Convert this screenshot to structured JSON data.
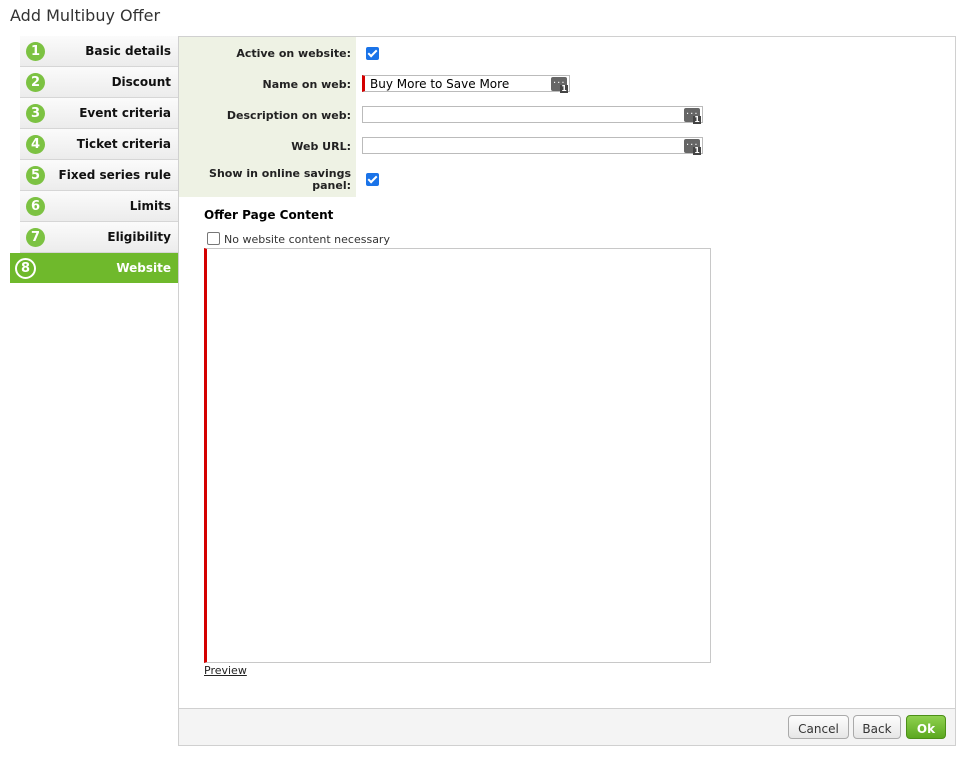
{
  "window": {
    "title": "Add Multibuy Offer"
  },
  "steps": [
    {
      "num": "1",
      "label": "Basic details"
    },
    {
      "num": "2",
      "label": "Discount"
    },
    {
      "num": "3",
      "label": "Event criteria"
    },
    {
      "num": "4",
      "label": "Ticket criteria"
    },
    {
      "num": "5",
      "label": "Fixed series rule"
    },
    {
      "num": "6",
      "label": "Limits"
    },
    {
      "num": "7",
      "label": "Eligibility"
    },
    {
      "num": "8",
      "label": "Website",
      "active": true
    }
  ],
  "form": {
    "active_label": "Active on website:",
    "active_checked": true,
    "name_label": "Name on web:",
    "name_value": "Buy More to Save More",
    "description_label": "Description on web:",
    "description_value": "",
    "url_label": "Web URL:",
    "url_value": "",
    "savings_label_line1": "Show in online savings",
    "savings_label_line2": "panel:",
    "savings_checked": true,
    "field_icon": "text-lookup-icon",
    "field_badge": "1"
  },
  "content": {
    "section_title": "Offer Page Content",
    "no_content_label": "No website content necessary",
    "no_content_checked": false,
    "preview_link": "Preview"
  },
  "footer": {
    "cancel": "Cancel",
    "back": "Back",
    "ok": "Ok"
  },
  "colors": {
    "accent": "#6fb92c",
    "required": "#d40000",
    "checkbox": "#1a73e8"
  }
}
